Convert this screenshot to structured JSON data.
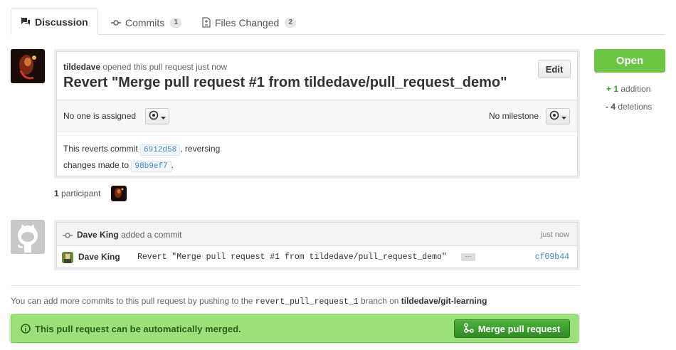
{
  "tabs": [
    {
      "label": "Discussion"
    },
    {
      "label": "Commits",
      "count": "1"
    },
    {
      "label": "Files Changed",
      "count": "2"
    }
  ],
  "pr": {
    "author": "tildedave",
    "opened_text": "opened this pull request just now",
    "title": "Revert \"Merge pull request #1 from tildedave/pull_request_demo\"",
    "edit_label": "Edit",
    "assignee_text": "No one is assigned",
    "milestone_text": "No milestone",
    "body_prefix": "This reverts commit",
    "body_sha1": "6912d58",
    "body_middle": ", reversing",
    "body_line2": "changes made to",
    "body_sha2": "98b9ef7",
    "body_end": "."
  },
  "participants": {
    "count": "1",
    "label": "participant"
  },
  "commit_event": {
    "author": "Dave King",
    "action": "added a commit",
    "time": "just now",
    "commit_author": "Dave King",
    "commit_message": "Revert \"Merge pull request #1 from tildedave/pull_request_demo\"",
    "ellipsis": "···",
    "sha": "cf09b44"
  },
  "footer": {
    "prefix": "You can add more commits to this pull request by pushing to the",
    "branch": "revert_pull_request_1",
    "middle": "branch on",
    "repo": "tildedave/git-learning"
  },
  "merge": {
    "status": "This pull request can be automatically merged.",
    "button": "Merge pull request"
  },
  "sidebar": {
    "state": "Open",
    "additions_count": "1",
    "additions_label": "addition",
    "deletions_count": "4",
    "deletions_label": "deletions"
  },
  "colors": {
    "green": "#6cc644",
    "merge_bg": "#9ce07a",
    "merge_button": "#3c9a2e",
    "link": "#4183c4"
  }
}
